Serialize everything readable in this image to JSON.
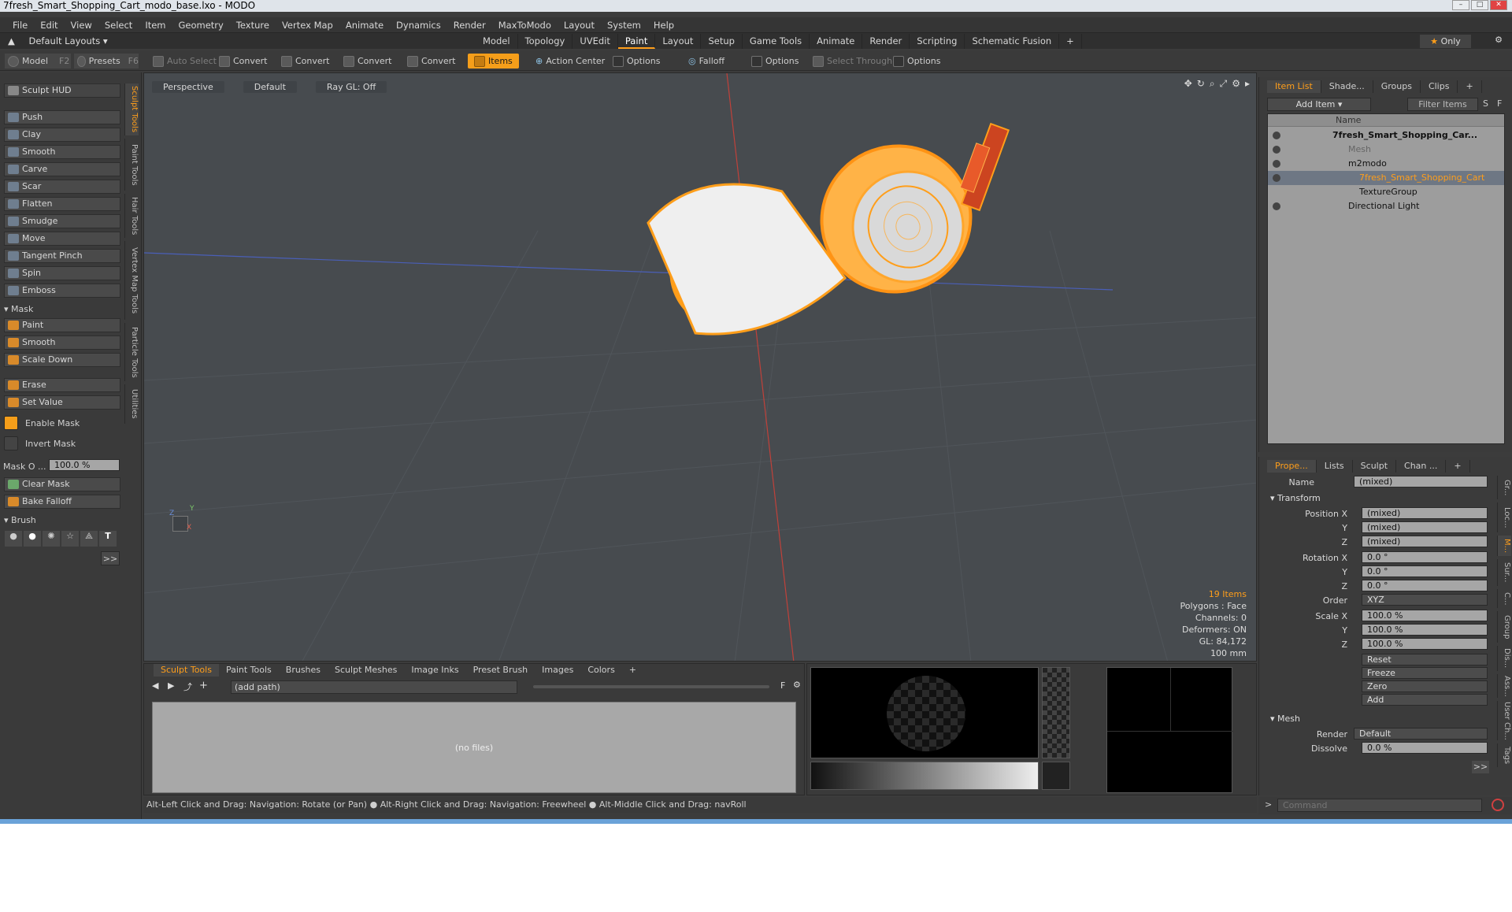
{
  "window": {
    "title": "7fresh_Smart_Shopping_Cart_modo_base.lxo - MODO"
  },
  "menubar": [
    "File",
    "Edit",
    "View",
    "Select",
    "Item",
    "Geometry",
    "Texture",
    "Vertex Map",
    "Animate",
    "Dynamics",
    "Render",
    "MaxToModo",
    "Layout",
    "System",
    "Help"
  ],
  "layoutbar": {
    "layouts_label": "Default Layouts",
    "tabs": [
      "Model",
      "Topology",
      "UVEdit",
      "Paint",
      "Layout",
      "Setup",
      "Game Tools",
      "Animate",
      "Render",
      "Scripting",
      "Schematic Fusion"
    ],
    "active_tab": "Paint",
    "plus": "+",
    "only_label": "Only"
  },
  "toolbar": {
    "model": "Model",
    "model_key": "F2",
    "presets": "Presets",
    "presets_key": "F6",
    "auto_select": "Auto Select",
    "convert": "Convert",
    "items": "Items",
    "action_center": "Action Center",
    "options": "Options",
    "falloff": "Falloff",
    "select_through": "Select Through"
  },
  "leftpanel": {
    "hud": "Sculpt HUD",
    "tools": [
      "Push",
      "Clay",
      "Smooth",
      "Carve",
      "Scar",
      "Flatten",
      "Smudge",
      "Move",
      "Tangent Pinch",
      "Spin",
      "Emboss"
    ],
    "mask_header": "Mask",
    "mask_tools": [
      "Paint",
      "Smooth",
      "Scale Down"
    ],
    "erase": "Erase",
    "set_value": "Set Value",
    "enable_mask": "Enable Mask",
    "invert_mask": "Invert Mask",
    "mask_opacity_label": "Mask O ...",
    "mask_opacity_value": "100.0 %",
    "clear_mask": "Clear Mask",
    "bake_falloff": "Bake Falloff",
    "brush_header": "Brush",
    "more": ">>",
    "vtabs": [
      "Sculpt Tools",
      "Paint Tools",
      "Hair Tools",
      "Vertex Map Tools",
      "Particle Tools",
      "Utilities"
    ]
  },
  "viewport": {
    "view": "Perspective",
    "shading": "Default",
    "raygl": "Ray GL: Off",
    "stats": {
      "items": "19 Items",
      "polygons": "Polygons : Face",
      "channels": "Channels: 0",
      "deformers": "Deformers: ON",
      "gl": "GL: 84,172",
      "scale": "100 mm"
    },
    "axis_y": "Y",
    "axis_x": "X",
    "axis_z": "Z"
  },
  "assetpanel": {
    "tabs": [
      "Sculpt Tools",
      "Paint Tools",
      "Brushes",
      "Sculpt Meshes",
      "Image Inks",
      "Preset Brush",
      "Images",
      "Colors"
    ],
    "active": "Sculpt Tools",
    "plus": "+",
    "path": "(add path)",
    "f_btn": "F",
    "empty": "(no files)"
  },
  "itemlist": {
    "tabs": [
      "Item List",
      "Shade...",
      "Groups",
      "Clips"
    ],
    "plus": "+",
    "add_item": "Add Item",
    "filter": "Filter Items",
    "s_btn": "S",
    "f_btn": "F",
    "name_header": "Name",
    "rows": [
      {
        "label": "7fresh_Smart_Shopping_Car...",
        "indent": 0
      },
      {
        "label": "Mesh",
        "indent": 1
      },
      {
        "label": "m2modo",
        "indent": 1
      },
      {
        "label": "7fresh_Smart_Shopping_Cart",
        "indent": 2
      },
      {
        "label": "TextureGroup",
        "indent": 2
      },
      {
        "label": "Directional Light",
        "indent": 1
      }
    ]
  },
  "props": {
    "tabs": [
      "Prope...",
      "Lists",
      "Sculpt",
      "Chan ..."
    ],
    "plus": "+",
    "name_label": "Name",
    "name_value": "(mixed)",
    "transform": "Transform",
    "position_x": "Position X",
    "y": "Y",
    "z": "Z",
    "pos_vals": [
      "(mixed)",
      "(mixed)",
      "(mixed)"
    ],
    "rotation_x": "Rotation X",
    "rot_vals": [
      "0.0 °",
      "0.0 °",
      "0.0 °"
    ],
    "order_label": "Order",
    "order_value": "XYZ",
    "scale_x": "Scale X",
    "scale_vals": [
      "100.0 %",
      "100.0 %",
      "100.0 %"
    ],
    "reset": "Reset",
    "freeze": "Freeze",
    "zero": "Zero",
    "add": "Add",
    "mesh": "Mesh",
    "render_label": "Render",
    "render_value": "Default",
    "dissolve_label": "Dissolve",
    "dissolve_value": "0.0 %",
    "more": ">>",
    "side_tabs": [
      "Gr...",
      "Loc...",
      "M...",
      "Sur...",
      "C...",
      "Group",
      "Dis...",
      "Ass...",
      "User Ch...",
      "Tags"
    ]
  },
  "statusbar": {
    "text": "Alt-Left Click and Drag: Navigation: Rotate (or Pan) ● Alt-Right Click and Drag: Navigation: Freewheel ● Alt-Middle Click and Drag: navRoll"
  },
  "command": {
    "placeholder": "Command",
    "prompt": ">"
  },
  "colors": {
    "accent": "#ff9e1a",
    "wire": "#ffa020"
  }
}
